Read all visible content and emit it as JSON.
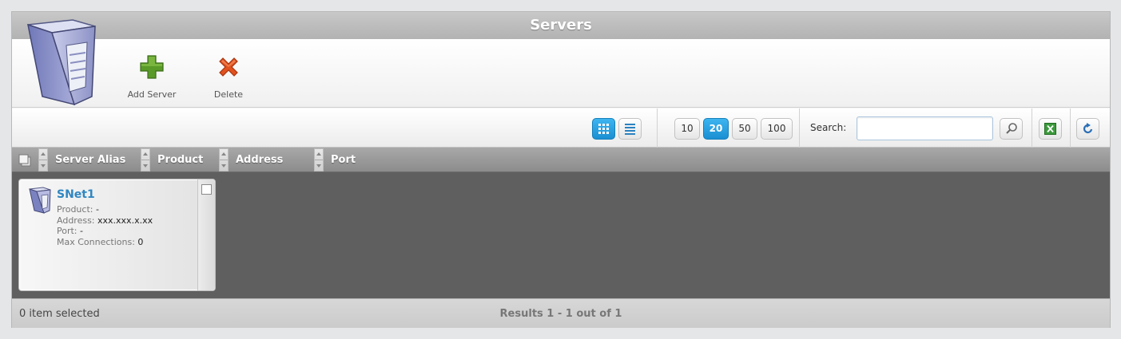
{
  "window": {
    "title": "Servers"
  },
  "toolbar": {
    "add_label": "Add Server",
    "delete_label": "Delete"
  },
  "controls": {
    "page_sizes": [
      "10",
      "20",
      "50",
      "100"
    ],
    "active_page_size": "20",
    "search_label": "Search:",
    "search_value": "",
    "view_mode": "grid"
  },
  "columns": [
    "Server Alias",
    "Product",
    "Address",
    "Port"
  ],
  "servers": [
    {
      "alias": "SNet1",
      "product_label": "Product:",
      "product": "-",
      "address_label": "Address:",
      "address": "xxx.xxx.x.xx",
      "port_label": "Port:",
      "port": "-",
      "max_conn_label": "Max Connections:",
      "max_conn": "0"
    }
  ],
  "footer": {
    "selection": "0 item selected",
    "results": "Results 1 - 1 out of 1"
  },
  "colors": {
    "accent": "#1a8fd2",
    "title_link": "#2f86c2",
    "grid_bg": "#5f5f5f"
  }
}
